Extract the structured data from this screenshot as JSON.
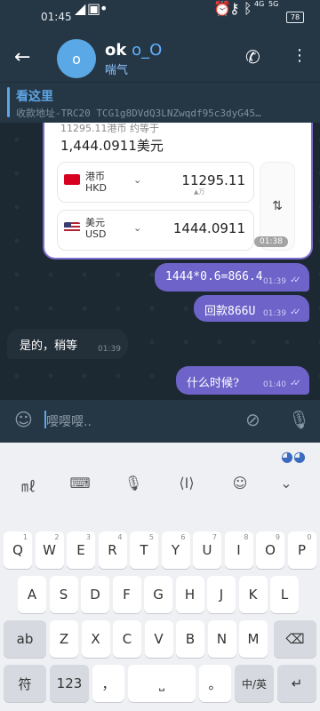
{
  "status_bar": {
    "time": "01:45",
    "battery": "78",
    "signal_a": "4G",
    "signal_b": "5G"
  },
  "header": {
    "avatar_letter": "o",
    "name": "ok",
    "name_sub": " o_O",
    "status": "喘气"
  },
  "pinned": {
    "title": "看这里",
    "text": "收款地址-TRC20    TCG1g8DVdQ3LNZwqdf95c3dyG45…"
  },
  "image_message": {
    "faded_text": "11295.11港币 约等于",
    "total": "1,444.0911美元",
    "from": {
      "name": "港币",
      "code": "HKD",
      "amount": "11295.11",
      "sub": "▲万"
    },
    "to": {
      "name": "美元",
      "code": "USD",
      "amount": "1444.0911"
    },
    "time": "01:38"
  },
  "messages": [
    {
      "text": "1444*0.6=866.4",
      "time": "01:39",
      "ticks": "✓✓"
    },
    {
      "text": "回款866U",
      "time": "01:39",
      "ticks": "✓✓"
    },
    {
      "text": "是的，稍等",
      "time": "01:39"
    },
    {
      "text": "什么时候?",
      "time": "01:40",
      "ticks": "✓✓"
    }
  ],
  "input": {
    "value": "嘤嘤嘤.."
  },
  "keyboard": {
    "row1": [
      "Q",
      "W",
      "E",
      "R",
      "T",
      "Y",
      "U",
      "I",
      "O",
      "P"
    ],
    "row1_nums": [
      "1",
      "2",
      "3",
      "4",
      "5",
      "6",
      "7",
      "8",
      "9",
      "0"
    ],
    "row2": [
      "A",
      "S",
      "D",
      "F",
      "G",
      "H",
      "J",
      "K",
      "L"
    ],
    "row3": [
      "Z",
      "X",
      "C",
      "V",
      "B",
      "N",
      "M"
    ],
    "shift_label": "ab",
    "sym_label": "符",
    "num_label": "123",
    "comma": "，",
    "period": "。",
    "lang_label": "中/英"
  }
}
